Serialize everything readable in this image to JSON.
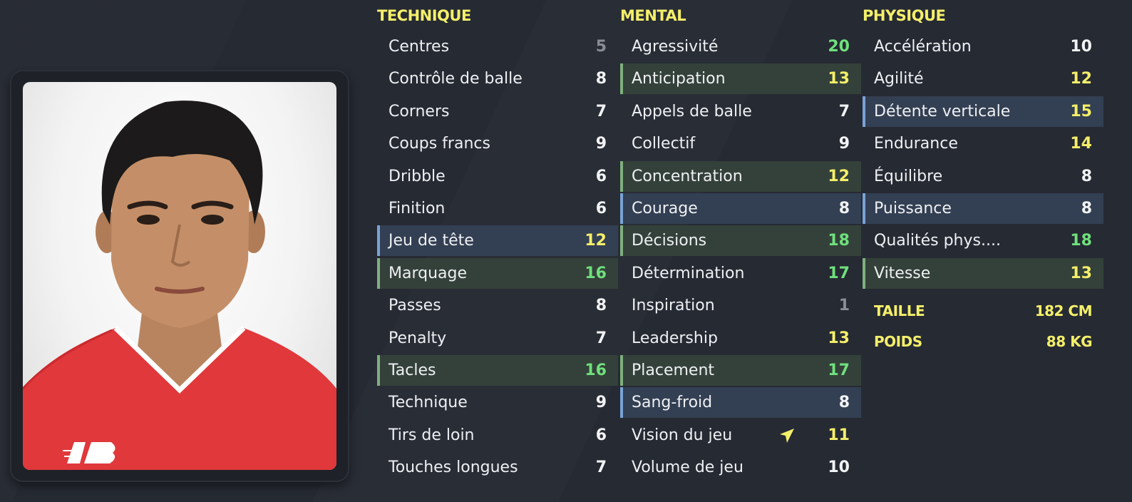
{
  "technique": {
    "title": "TECHNIQUE",
    "rows": [
      {
        "label": "Centres",
        "value": "5",
        "tone": "grey",
        "hl": ""
      },
      {
        "label": "Contrôle de balle",
        "value": "8",
        "tone": "white",
        "hl": ""
      },
      {
        "label": "Corners",
        "value": "7",
        "tone": "white",
        "hl": ""
      },
      {
        "label": "Coups francs",
        "value": "9",
        "tone": "white",
        "hl": ""
      },
      {
        "label": "Dribble",
        "value": "6",
        "tone": "white",
        "hl": ""
      },
      {
        "label": "Finition",
        "value": "6",
        "tone": "white",
        "hl": ""
      },
      {
        "label": "Jeu de tête",
        "value": "12",
        "tone": "yellow",
        "hl": "blue"
      },
      {
        "label": "Marquage",
        "value": "16",
        "tone": "green",
        "hl": "green"
      },
      {
        "label": "Passes",
        "value": "8",
        "tone": "white",
        "hl": ""
      },
      {
        "label": "Penalty",
        "value": "7",
        "tone": "white",
        "hl": ""
      },
      {
        "label": "Tacles",
        "value": "16",
        "tone": "green",
        "hl": "green"
      },
      {
        "label": "Technique",
        "value": "9",
        "tone": "white",
        "hl": ""
      },
      {
        "label": "Tirs de loin",
        "value": "6",
        "tone": "white",
        "hl": ""
      },
      {
        "label": "Touches longues",
        "value": "7",
        "tone": "white",
        "hl": ""
      }
    ]
  },
  "mental": {
    "title": "MENTAL",
    "rows": [
      {
        "label": "Agressivité",
        "value": "20",
        "tone": "green",
        "hl": ""
      },
      {
        "label": "Anticipation",
        "value": "13",
        "tone": "yellow",
        "hl": "green"
      },
      {
        "label": "Appels de balle",
        "value": "7",
        "tone": "white",
        "hl": ""
      },
      {
        "label": "Collectif",
        "value": "9",
        "tone": "white",
        "hl": ""
      },
      {
        "label": "Concentration",
        "value": "12",
        "tone": "yellow",
        "hl": "green"
      },
      {
        "label": "Courage",
        "value": "8",
        "tone": "white",
        "hl": "blue"
      },
      {
        "label": "Décisions",
        "value": "18",
        "tone": "green",
        "hl": "green"
      },
      {
        "label": "Détermination",
        "value": "17",
        "tone": "green",
        "hl": ""
      },
      {
        "label": "Inspiration",
        "value": "1",
        "tone": "grey",
        "hl": ""
      },
      {
        "label": "Leadership",
        "value": "13",
        "tone": "yellow",
        "hl": ""
      },
      {
        "label": "Placement",
        "value": "17",
        "tone": "green",
        "hl": "green"
      },
      {
        "label": "Sang-froid",
        "value": "8",
        "tone": "white",
        "hl": "blue"
      },
      {
        "label": "Vision du jeu",
        "value": "11",
        "tone": "yellow",
        "hl": ""
      },
      {
        "label": "Volume de jeu",
        "value": "10",
        "tone": "white",
        "hl": ""
      }
    ]
  },
  "physique": {
    "title": "PHYSIQUE",
    "rows": [
      {
        "label": "Accélération",
        "value": "10",
        "tone": "white",
        "hl": ""
      },
      {
        "label": "Agilité",
        "value": "12",
        "tone": "yellow",
        "hl": ""
      },
      {
        "label": "Détente verticale",
        "value": "15",
        "tone": "yellow",
        "hl": "blue"
      },
      {
        "label": "Endurance",
        "value": "14",
        "tone": "yellow",
        "hl": ""
      },
      {
        "label": "Équilibre",
        "value": "8",
        "tone": "white",
        "hl": ""
      },
      {
        "label": "Puissance",
        "value": "8",
        "tone": "white",
        "hl": "blue"
      },
      {
        "label": "Qualités phys....",
        "value": "18",
        "tone": "green",
        "hl": ""
      },
      {
        "label": "Vitesse",
        "value": "13",
        "tone": "yellow",
        "hl": "green"
      }
    ],
    "height_label": "TAILLE",
    "height_value": "182 CM",
    "weight_label": "POIDS",
    "weight_value": "88 KG"
  },
  "photo": {
    "kit_logo": "NB",
    "icon": "player-portrait"
  },
  "colors": {
    "background": "#262a33",
    "title_yellow": "#f4ef6a",
    "value_green": "#6fe07c",
    "value_yellow": "#f4ef6a",
    "value_grey": "#8a8d93",
    "highlight_green": "#34413a",
    "highlight_blue": "#333f52"
  }
}
